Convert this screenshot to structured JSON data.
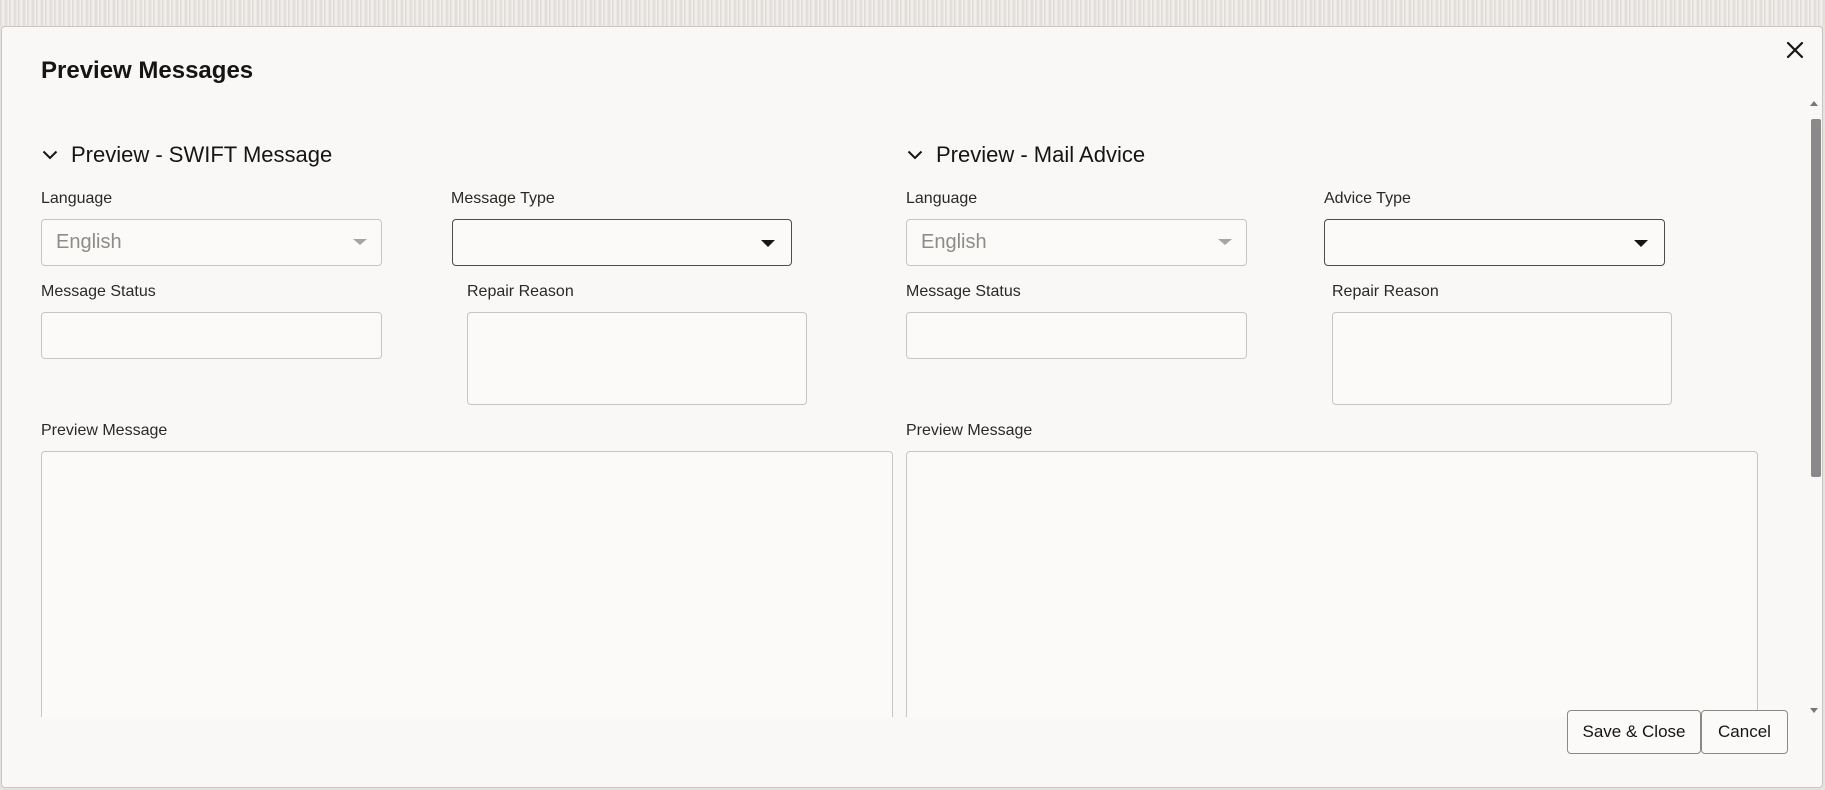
{
  "dialog": {
    "title": "Preview Messages"
  },
  "swift": {
    "section_title": "Preview - SWIFT Message",
    "language_label": "Language",
    "language_value": "English",
    "message_type_label": "Message Type",
    "message_type_value": "",
    "message_status_label": "Message Status",
    "message_status_value": "",
    "repair_reason_label": "Repair Reason",
    "repair_reason_value": "",
    "preview_label": "Preview Message",
    "preview_value": ""
  },
  "mail": {
    "section_title": "Preview - Mail Advice",
    "language_label": "Language",
    "language_value": "English",
    "advice_type_label": "Advice Type",
    "advice_type_value": "",
    "message_status_label": "Message Status",
    "message_status_value": "",
    "repair_reason_label": "Repair Reason",
    "repair_reason_value": "",
    "preview_label": "Preview Message",
    "preview_value": ""
  },
  "footer": {
    "save_close_label": "Save & Close",
    "cancel_label": "Cancel"
  },
  "icons": {
    "close": "close-icon",
    "collapse": "chevron-down-icon",
    "dropdown": "caret-down-icon"
  }
}
